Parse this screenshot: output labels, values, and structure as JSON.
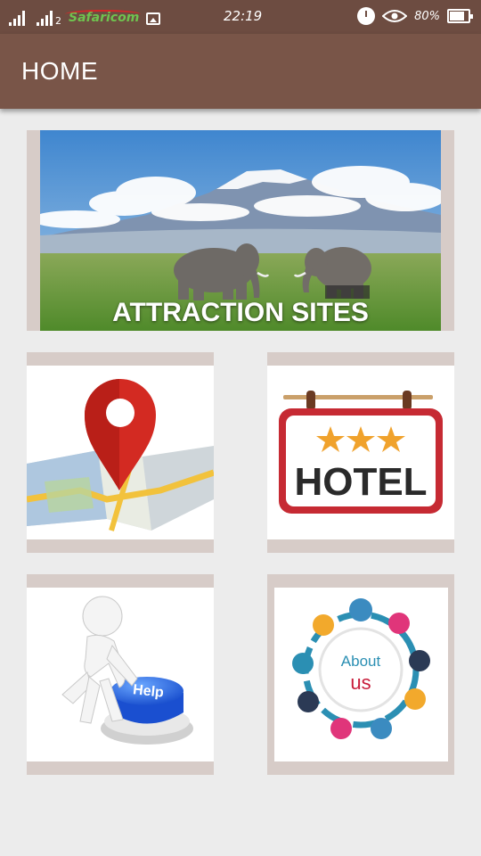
{
  "status_bar": {
    "sim1_tag": "",
    "sim2_tag": "2",
    "carrier": "Safaricom",
    "time": "22:19",
    "battery_percent": "80%",
    "battery_level": 0.8
  },
  "app_bar": {
    "title": "HOME"
  },
  "tiles": [
    {
      "name": "attraction-sites",
      "label": "ATTRACTION SITES"
    },
    {
      "name": "map"
    },
    {
      "name": "hotel",
      "label": "HOTEL"
    },
    {
      "name": "help",
      "label": "Help"
    },
    {
      "name": "about-us",
      "label_line1": "About",
      "label_line2": "us"
    }
  ],
  "colors": {
    "status_bar": "#6d4c41",
    "app_bar": "#795548",
    "tile_frame": "#d7ccc8",
    "background": "#ececec"
  }
}
